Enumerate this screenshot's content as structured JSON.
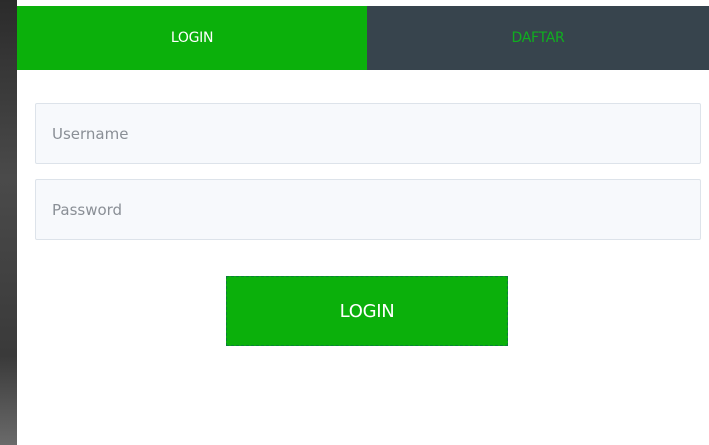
{
  "tabs": {
    "login_label": "LOGIN",
    "daftar_label": "DAFTAR"
  },
  "form": {
    "username_placeholder": "Username",
    "password_placeholder": "Password",
    "username_value": "",
    "password_value": ""
  },
  "submit": {
    "label": "LOGIN"
  },
  "colors": {
    "accent_green": "#0bb00b",
    "tab_dark": "#37444d",
    "field_bg": "#f7f9fc",
    "field_border": "#dde3ea"
  }
}
